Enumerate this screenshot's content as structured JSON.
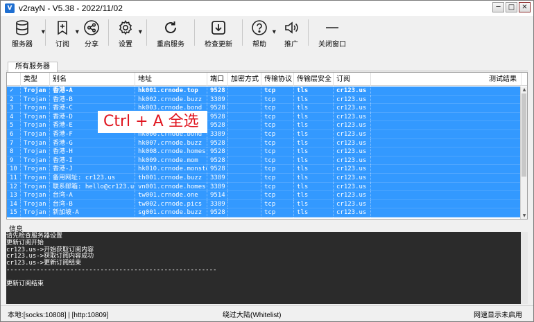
{
  "window": {
    "title": "v2rayN - V5.38 - 2022/11/02",
    "minimize": "─",
    "maximize": "□",
    "close": "✕"
  },
  "toolbar": [
    {
      "name": "servers",
      "label": "服务器",
      "icon": "database-icon",
      "dropdown": true
    },
    {
      "name": "subscribe",
      "label": "订阅",
      "icon": "bookmark-plus-icon",
      "dropdown": true
    },
    {
      "name": "share",
      "label": "分享",
      "icon": "share-icon",
      "dropdown": false
    },
    {
      "name": "settings",
      "label": "设置",
      "icon": "gear-icon",
      "dropdown": true
    },
    {
      "name": "restart",
      "label": "重启服务",
      "icon": "refresh-icon",
      "dropdown": false
    },
    {
      "name": "check-update",
      "label": "检查更新",
      "icon": "download-box-icon",
      "dropdown": true
    },
    {
      "name": "help",
      "label": "帮助",
      "icon": "help-circle-icon",
      "dropdown": true
    },
    {
      "name": "promote",
      "label": "推广",
      "icon": "speaker-icon",
      "dropdown": false
    },
    {
      "name": "close-window",
      "label": "关闭窗口",
      "icon": "minus-line-icon",
      "dropdown": false
    }
  ],
  "tab": {
    "label": "所有服务器"
  },
  "table": {
    "columns": [
      "",
      "类型",
      "别名",
      "地址",
      "端口",
      "加密方式",
      "传输协议",
      "传输层安全",
      "订阅",
      "测试结果"
    ],
    "rows": [
      [
        "✓",
        "Trojan",
        "香港-A",
        "hk001.crnode.top",
        "9528",
        "",
        "tcp",
        "tls",
        "cr123.us",
        ""
      ],
      [
        "2",
        "Trojan",
        "香港-B",
        "hk002.crnode.buzz",
        "3389",
        "",
        "tcp",
        "tls",
        "cr123.us",
        ""
      ],
      [
        "3",
        "Trojan",
        "香港-C",
        "hk003.crnode.bond",
        "9528",
        "",
        "tcp",
        "tls",
        "cr123.us",
        ""
      ],
      [
        "4",
        "Trojan",
        "香港-D",
        "",
        "9528",
        "",
        "tcp",
        "tls",
        "cr123.us",
        ""
      ],
      [
        "5",
        "Trojan",
        "香港-E",
        "",
        "9528",
        "",
        "tcp",
        "tls",
        "cr123.us",
        ""
      ],
      [
        "6",
        "Trojan",
        "香港-F",
        "hk006.crnode.bond",
        "3389",
        "",
        "tcp",
        "tls",
        "cr123.us",
        ""
      ],
      [
        "7",
        "Trojan",
        "香港-G",
        "hk007.crnode.buzz",
        "9528",
        "",
        "tcp",
        "tls",
        "cr123.us",
        ""
      ],
      [
        "8",
        "Trojan",
        "香港-H",
        "hk008.crnode.homes",
        "9528",
        "",
        "tcp",
        "tls",
        "cr123.us",
        ""
      ],
      [
        "9",
        "Trojan",
        "香港-I",
        "hk009.crnode.mom",
        "9528",
        "",
        "tcp",
        "tls",
        "cr123.us",
        ""
      ],
      [
        "10",
        "Trojan",
        "香港-J",
        "hk010.crnode.monster",
        "9528",
        "",
        "tcp",
        "tls",
        "cr123.us",
        ""
      ],
      [
        "11",
        "Trojan",
        "备用网址: cr123.us",
        "th001.crnode.buzz",
        "3389",
        "",
        "tcp",
        "tls",
        "cr123.us",
        ""
      ],
      [
        "12",
        "Trojan",
        "联系邮箱: hello@cr123.us",
        "vn001.crnode.homes",
        "3389",
        "",
        "tcp",
        "tls",
        "cr123.us",
        ""
      ],
      [
        "13",
        "Trojan",
        "台湾-A",
        "tw001.crnode.one",
        "9514",
        "",
        "tcp",
        "tls",
        "cr123.us",
        ""
      ],
      [
        "14",
        "Trojan",
        "台湾-B",
        "tw002.crnode.pics",
        "3389",
        "",
        "tcp",
        "tls",
        "cr123.us",
        ""
      ],
      [
        "15",
        "Trojan",
        "新加坡-A",
        "sg001.crnode.buzz",
        "9528",
        "",
        "tcp",
        "tls",
        "cr123.us",
        ""
      ]
    ]
  },
  "overlay": {
    "text": "Ctrl + A 全选",
    "color": "#e0141e"
  },
  "info": {
    "title": "信息",
    "log": [
      "请先检查服务器设置",
      "更新订阅开始",
      "cr123.us->开始获取订阅内容",
      "cr123.us->获取订阅内容成功",
      "cr123.us->更新订阅结束",
      "--------------------------------------------------------",
      "",
      "更新订阅结束"
    ]
  },
  "status": {
    "local": "本地:[socks:10808] | [http:10809]",
    "route": "绕过大陆(Whitelist)",
    "speed": "网速显示未启用"
  },
  "colors": {
    "selection": "#3399ff",
    "log_bg": "#2b2b2b"
  }
}
